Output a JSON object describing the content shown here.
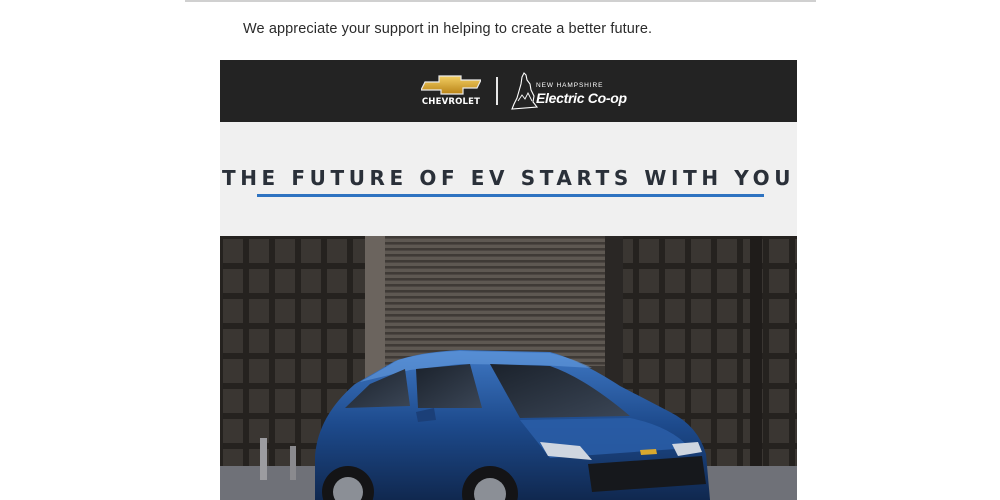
{
  "intro": {
    "text": "We appreciate your support in helping to create a better future."
  },
  "brand_bar": {
    "chevrolet_wordmark": "CHEVROLET",
    "coop_subtitle": "NEW HAMPSHIRE",
    "coop_name": "Electric Co-op"
  },
  "headline": {
    "text": "THE FUTURE OF EV STARTS WITH YOU"
  },
  "hero": {
    "image": "blue-chevrolet-bolt-ev-in-front-of-building"
  },
  "colors": {
    "brand_bar": "#232323",
    "headline_band": "#f0f0f0",
    "headline_text": "#2a3039",
    "underline": "#2e73c1",
    "car_blue": "#1d4a8c",
    "bowtie_gold": "#d9a82e"
  }
}
